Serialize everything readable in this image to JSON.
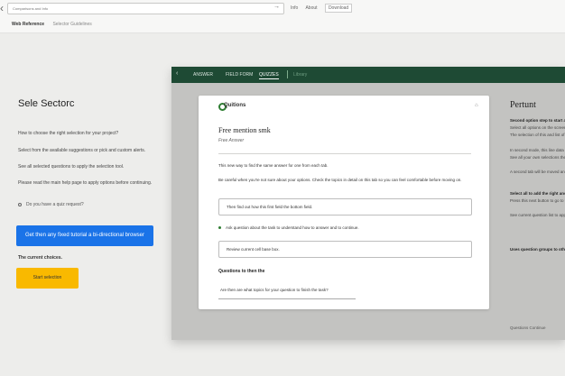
{
  "browser": {
    "url_text": "Comparisons and Info",
    "top_links": [
      "Info",
      "About",
      "Download"
    ],
    "crumbs": [
      "Web Reference",
      "Selector Guidelines"
    ]
  },
  "left": {
    "title": "Sele Sectorc",
    "lines": [
      "How to choose the right selection for your project?",
      "Select from the available suggestions or pick and custom alerts.",
      "See all selected questions to apply the selection tool.",
      "Please read the main help page to apply options before continuing."
    ],
    "radio_label": "Do you have a quiz request?",
    "blue_button": "Get then any fixed tutorial a bi-directional browser",
    "note": "The current choices.",
    "yellow_button": "Start selection"
  },
  "app": {
    "nav_tabs": [
      "ANSWER",
      "FIELD FORM",
      "QUIZZES"
    ],
    "nav_faint": "Library",
    "card": {
      "brand": "Quitions",
      "heading": "Free mention smk",
      "sub": "Free Answer",
      "text1": "This new way to find the same answer for one from each tab.",
      "text2": "Be careful when you're not sure about your options. Check the topics in detail on this tab so you can feel comfortable before moving on.",
      "box1": "Then find out how this first field the bottom field.",
      "radio": "Ask question about the task to understand how to answer and to continue.",
      "box2": "Review current cell base box.",
      "section": "Questions to then the",
      "input": "Are then are what topics for your question to finish the task?"
    },
    "footer": "Questions Continue"
  },
  "right": {
    "title": "Pertunt",
    "lines": [
      "Second option step to start ask.",
      "Select all options on the screen.",
      "The selection of this and list of options.",
      "In second mode, this line data to use it.",
      "See all your own selections then the panel.",
      "A second tab will be moved and applied.",
      "Select all to add the right answer field.",
      "Press this next button to go to tab.",
      "See current question list to apply.",
      "Uses question groups to other items."
    ]
  },
  "colors": {
    "nav_bg": "#1e4a34",
    "blue_button": "#1a73e8",
    "yellow_button": "#f9b900",
    "app_frame": "#c3c3c1"
  }
}
